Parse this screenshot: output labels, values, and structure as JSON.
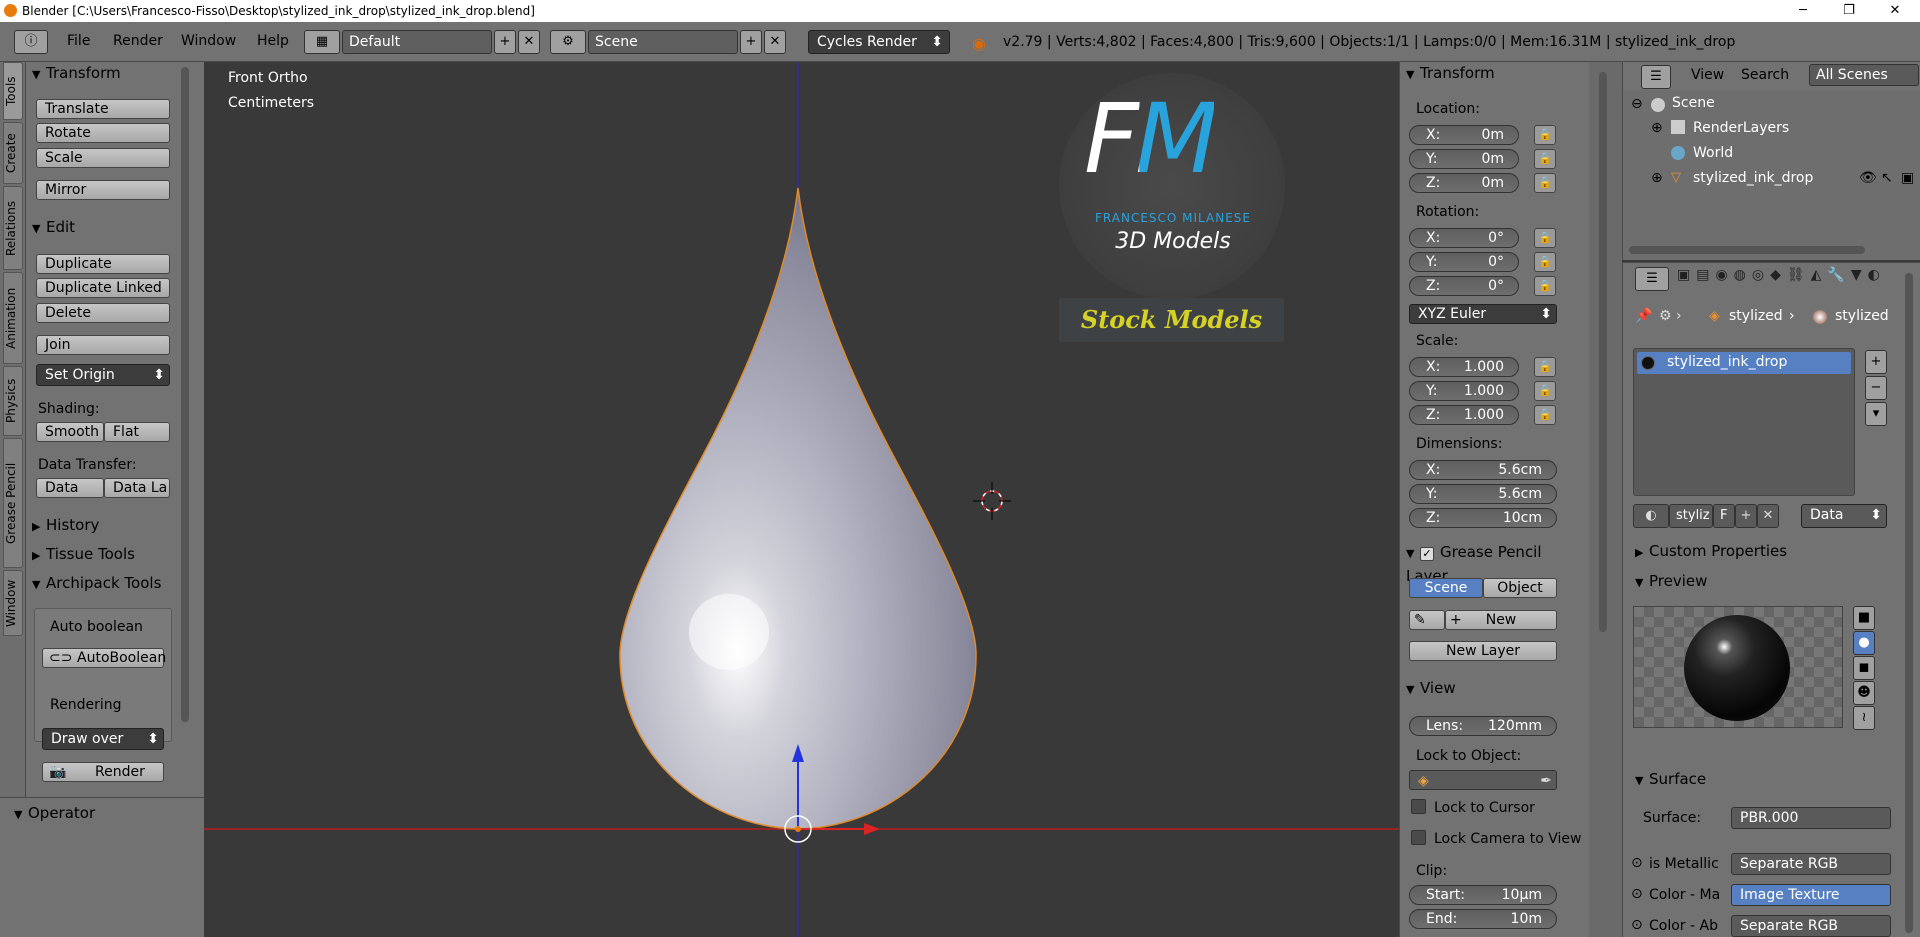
{
  "title": {
    "text": "Blender [C:\\Users\\Francesco-Fisso\\Desktop\\stylized_ink_drop\\stylized_ink_drop.blend]"
  },
  "menus": [
    "File",
    "Render",
    "Window",
    "Help"
  ],
  "layout": {
    "value": "Default"
  },
  "scene": {
    "value": "Scene"
  },
  "engine": {
    "value": "Cycles Render"
  },
  "stats": "v2.79 | Verts:4,802 | Faces:4,800 | Tris:9,600 | Objects:1/1 | Lamps:0/0 | Mem:16.31M | stylized_ink_drop",
  "tabs": [
    "Tools",
    "Create",
    "Relations",
    "Animation",
    "Physics",
    "Grease Pencil",
    "Window"
  ],
  "tools": {
    "transform_header": "Transform",
    "translate": "Translate",
    "rotate": "Rotate",
    "scale": "Scale",
    "mirror": "Mirror",
    "edit_header": "Edit",
    "duplicate": "Duplicate",
    "duplicate_linked": "Duplicate Linked",
    "delete": "Delete",
    "join": "Join",
    "set_origin": "Set Origin",
    "shading_label": "Shading:",
    "smooth": "Smooth",
    "flat": "Flat",
    "data_transfer_label": "Data Transfer:",
    "data": "Data",
    "data_la": "Data La",
    "history_header": "History",
    "tissue_header": "Tissue Tools",
    "archipack_header": "Archipack Tools",
    "auto_boolean_label": "Auto boolean",
    "autoboolean_btn": "AutoBoolean",
    "rendering_label": "Rendering",
    "draw_over": "Draw over",
    "render_btn": "Render",
    "operator_header": "Operator"
  },
  "viewport": {
    "view_name": "Front Ortho",
    "units": "Centimeters",
    "logo_letters": "FM",
    "logo_name": "FRANCESCO MILANESE",
    "logo_sub": "3D Models",
    "stock": "Stock Models"
  },
  "npanel": {
    "transform_header": "Transform",
    "location_label": "Location:",
    "location": [
      {
        "k": "X:",
        "v": "0m"
      },
      {
        "k": "Y:",
        "v": "0m"
      },
      {
        "k": "Z:",
        "v": "0m"
      }
    ],
    "rotation_label": "Rotation:",
    "rotation": [
      {
        "k": "X:",
        "v": "0°"
      },
      {
        "k": "Y:",
        "v": "0°"
      },
      {
        "k": "Z:",
        "v": "0°"
      }
    ],
    "rotation_mode": "XYZ Euler",
    "scale_label": "Scale:",
    "scale": [
      {
        "k": "X:",
        "v": "1.000"
      },
      {
        "k": "Y:",
        "v": "1.000"
      },
      {
        "k": "Z:",
        "v": "1.000"
      }
    ],
    "dimensions_label": "Dimensions:",
    "dimensions": [
      {
        "k": "X:",
        "v": "5.6cm"
      },
      {
        "k": "Y:",
        "v": "5.6cm"
      },
      {
        "k": "Z:",
        "v": "10cm"
      }
    ],
    "gp_header": "Grease Pencil Layer",
    "gp_scene": "Scene",
    "gp_object": "Object",
    "gp_new": "New",
    "gp_new_layer": "New Layer",
    "view_header": "View",
    "lens_k": "Lens:",
    "lens_v": "120mm",
    "lock_to_object": "Lock to Object:",
    "lock_to_cursor": "Lock to Cursor",
    "lock_camera": "Lock Camera to View",
    "clip_label": "Clip:",
    "clip_start_k": "Start:",
    "clip_start_v": "10µm",
    "clip_end_k": "End:",
    "clip_end_v": "10m"
  },
  "outliner": {
    "view": "View",
    "search": "Search",
    "all_scenes": "All Scenes",
    "items": [
      "Scene",
      "RenderLayers",
      "World",
      "stylized_ink_drop"
    ]
  },
  "props": {
    "crumb1": "stylized",
    "crumb2": "stylized",
    "material_slot": "stylized_ink_drop",
    "mat_name": "styliz",
    "mat_f": "F",
    "data_link": "Data",
    "custom_props": "Custom Properties",
    "preview": "Preview",
    "surface_header": "Surface",
    "surface_k": "Surface:",
    "surface_v": "PBR.000",
    "rows": [
      {
        "k": "is Metallic",
        "v": "Separate RGB"
      },
      {
        "k": "Color - Ma",
        "v": "Image Texture"
      },
      {
        "k": "Color - Ab",
        "v": "Separate RGB"
      }
    ]
  },
  "colors": {
    "accent_blue": "#5680c2",
    "logo_blue": "#29a3dc",
    "stock_yellow": "#d6d226"
  }
}
